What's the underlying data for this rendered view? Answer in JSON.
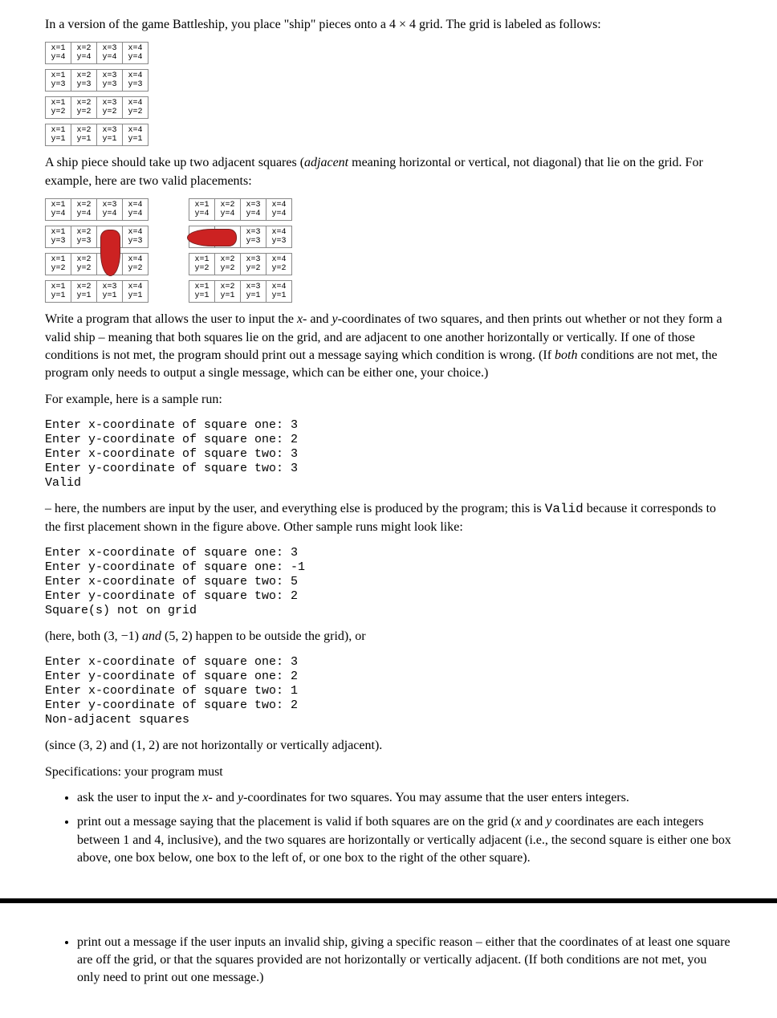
{
  "intro": "In a version of the game Battleship, you place \"ship\" pieces onto a 4 × 4 grid. The grid is labeled as follows:",
  "grid_cells": {
    "r4": [
      "x=1\ny=4",
      "x=2\ny=4",
      "x=3\ny=4",
      "x=4\ny=4"
    ],
    "r3": [
      "x=1\ny=3",
      "x=2\ny=3",
      "x=3\ny=3",
      "x=4\ny=3"
    ],
    "r2": [
      "x=1\ny=2",
      "x=2\ny=2",
      "x=3\ny=2",
      "x=4\ny=2"
    ],
    "r1": [
      "x=1\ny=1",
      "x=2\ny=1",
      "x=3\ny=1",
      "x=4\ny=1"
    ]
  },
  "para_adjacent_pre": "A ship piece should take up two adjacent squares (",
  "adjacent_word": "adjacent",
  "para_adjacent_post": " meaning horizontal or vertical, not diagonal) that lie on the grid. For example, here are two valid placements:",
  "para_program_pre": "Write a program that allows the user to input the ",
  "para_program_mid1": "- and ",
  "para_program_mid2": "-coordinates of two squares, and then prints out whether or not they form a valid ship – meaning that both squares lie on the grid, and are adjacent to one another horizontally or vertically. If one of those conditions is not met, the program should print out a message saying which condition is wrong. (If ",
  "both_word": "both",
  "para_program_end": " conditions are not met, the program only needs to output a single message, which can be either one, your choice.)",
  "sample_run_intro": "For example, here is a sample run:",
  "sample1": "Enter x-coordinate of square one: 3\nEnter y-coordinate of square one: 2\nEnter x-coordinate of square two: 3\nEnter y-coordinate of square two: 3\nValid",
  "explain1_pre": "– here, the numbers are input by the user, and everything else is produced by the program; this is ",
  "valid_code": "Valid",
  "explain1_post": " because it corresponds to the first placement shown in the figure above. Other sample runs might look like:",
  "sample2": "Enter x-coordinate of square one: 3\nEnter y-coordinate of square one: -1\nEnter x-coordinate of square two: 5\nEnter y-coordinate of square two: 2\nSquare(s) not on grid",
  "explain2_pre": "(here, both (3, −1) ",
  "and_word": "and",
  "explain2_post": " (5, 2) happen to be outside the grid), or",
  "sample3": "Enter x-coordinate of square one: 3\nEnter y-coordinate of square one: 2\nEnter x-coordinate of square two: 1\nEnter y-coordinate of square two: 2\nNon-adjacent squares",
  "explain3": "(since (3, 2) and (1, 2) are not horizontally or vertically adjacent).",
  "specs_heading": "Specifications: your program must",
  "spec1_pre": "ask the user to input the ",
  "spec1_mid": "- and ",
  "spec1_post": "-coordinates for two squares. You may assume that the user enters integers.",
  "spec2_pre": "print out a message saying that the placement is valid if both squares are on the grid (",
  "spec2_mid1": " and ",
  "spec2_mid2": " coordinates are each integers between 1 and 4, inclusive), and the two squares are horizontally or vertically adjacent (i.e., the second square is either one box above, one box below, one box to the left of, or one box to the right of the other square).",
  "spec3": "print out a message if the user inputs an invalid ship, giving a specific reason – either that the coordinates of at least one square are off the grid, or that the squares provided are not horizontally or vertically adjacent. (If both conditions are not met, you only need to print out one message.)",
  "x_var": "x",
  "y_var": "y"
}
